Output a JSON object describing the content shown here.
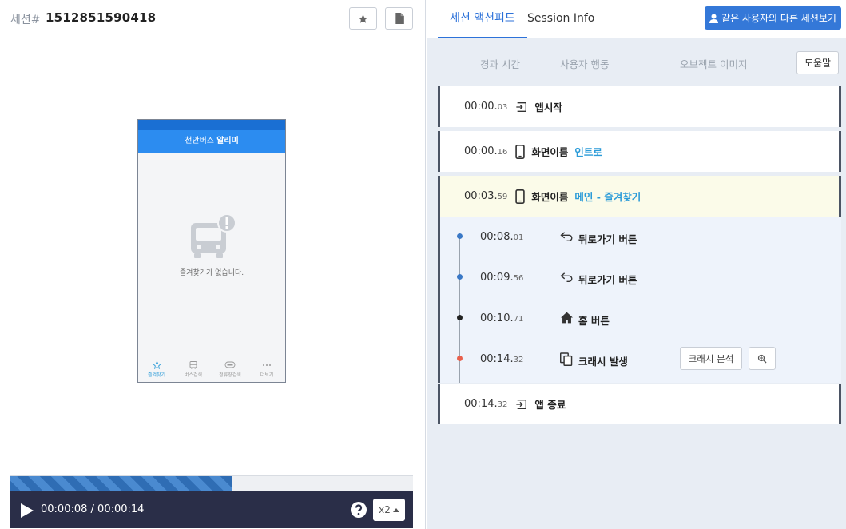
{
  "session": {
    "label": "세션#",
    "id": "1512851590418"
  },
  "phone": {
    "header_prefix": "천안버스",
    "header_bold": "알리미",
    "empty_text": "즐겨찾기가 없습니다.",
    "tabs": [
      {
        "label": "즐겨찾기",
        "icon": "star-icon",
        "active": true
      },
      {
        "label": "버스검색",
        "icon": "bus-icon",
        "active": false
      },
      {
        "label": "정류장검색",
        "icon": "bus-stop-icon",
        "active": false
      },
      {
        "label": "더보기",
        "icon": "more-icon",
        "active": false
      }
    ]
  },
  "player": {
    "time_current": "00:00:08",
    "time_separator": " / ",
    "time_total": "00:00:14",
    "progress": 0.55,
    "speed": "x2"
  },
  "tabs": {
    "actions": "세션 액션피드",
    "info": "Session Info"
  },
  "other_sessions_button": "같은 사용자의 다른 세션보기",
  "columns": {
    "time": "경과 시간",
    "action": "사용자 행동",
    "object": "오브젝트 이미지"
  },
  "help_button": "도움말",
  "events": [
    {
      "time_main": "00:00.",
      "time_ms": "03",
      "icon": "enter-icon",
      "label": "앱시작",
      "value": ""
    },
    {
      "time_main": "00:00.",
      "time_ms": "16",
      "icon": "smartphone-icon",
      "label": "화면이름",
      "value": "인트로"
    },
    {
      "time_main": "00:03.",
      "time_ms": "59",
      "icon": "smartphone-icon",
      "label": "화면이름",
      "value": "메인 - 즐겨찾기"
    }
  ],
  "sub_events": [
    {
      "time_main": "00:08.",
      "time_ms": "01",
      "icon": "back-arrow-icon",
      "label": "뒤로가기 버튼",
      "dot_color": "#3a78c6"
    },
    {
      "time_main": "00:09.",
      "time_ms": "56",
      "icon": "back-arrow-icon",
      "label": "뒤로가기 버튼",
      "dot_color": "#3a78c6"
    },
    {
      "time_main": "00:10.",
      "time_ms": "71",
      "icon": "home-icon",
      "label": "홈 버튼",
      "dot_color": "#222222"
    },
    {
      "time_main": "00:14.",
      "time_ms": "32",
      "icon": "copy-icon",
      "label": "크래시 발생",
      "dot_color": "#e9604c"
    }
  ],
  "crash_button": "크래시 분석",
  "end_event": {
    "time_main": "00:14.",
    "time_ms": "32",
    "icon": "enter-icon",
    "label": "앱 종료"
  },
  "colors": {
    "accent": "#3478d8",
    "player_bg": "#2a2e48",
    "highlight_row": "#fbfbe9",
    "screen_name": "#2b9bd8"
  }
}
